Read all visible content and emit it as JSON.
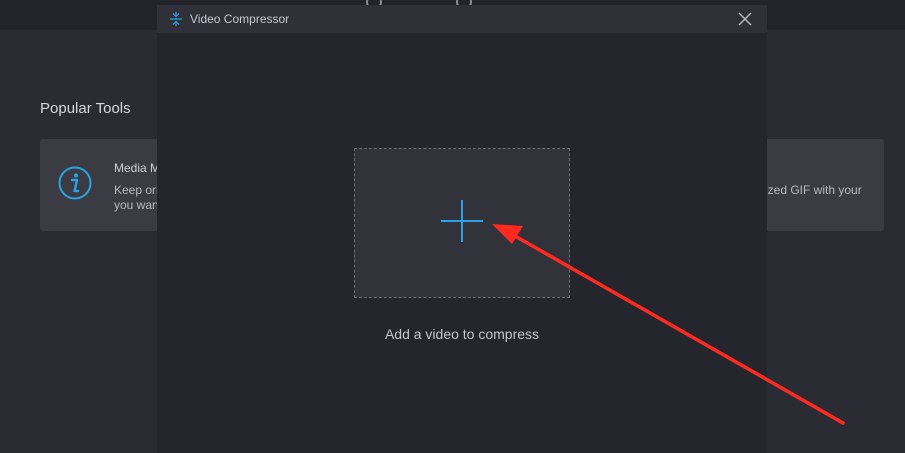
{
  "background": {
    "section_title": "Popular Tools",
    "left_card": {
      "title": "Media M",
      "desc_line1": "Keep origi",
      "desc_line2": "you want",
      "icon": "info-icon"
    },
    "right_card": {
      "desc_line1": "ized GIF with your"
    }
  },
  "dialog": {
    "title": "Video Compressor",
    "icon": "compress-icon",
    "close_icon": "close-icon",
    "drop_zone": {
      "icon": "plus-icon",
      "label": "Add a video to compress"
    }
  },
  "colors": {
    "accent": "#29a3e6",
    "annotation": "#ff2a1f",
    "dialog_bg": "#25262d",
    "page_bg": "#2b2c33"
  }
}
